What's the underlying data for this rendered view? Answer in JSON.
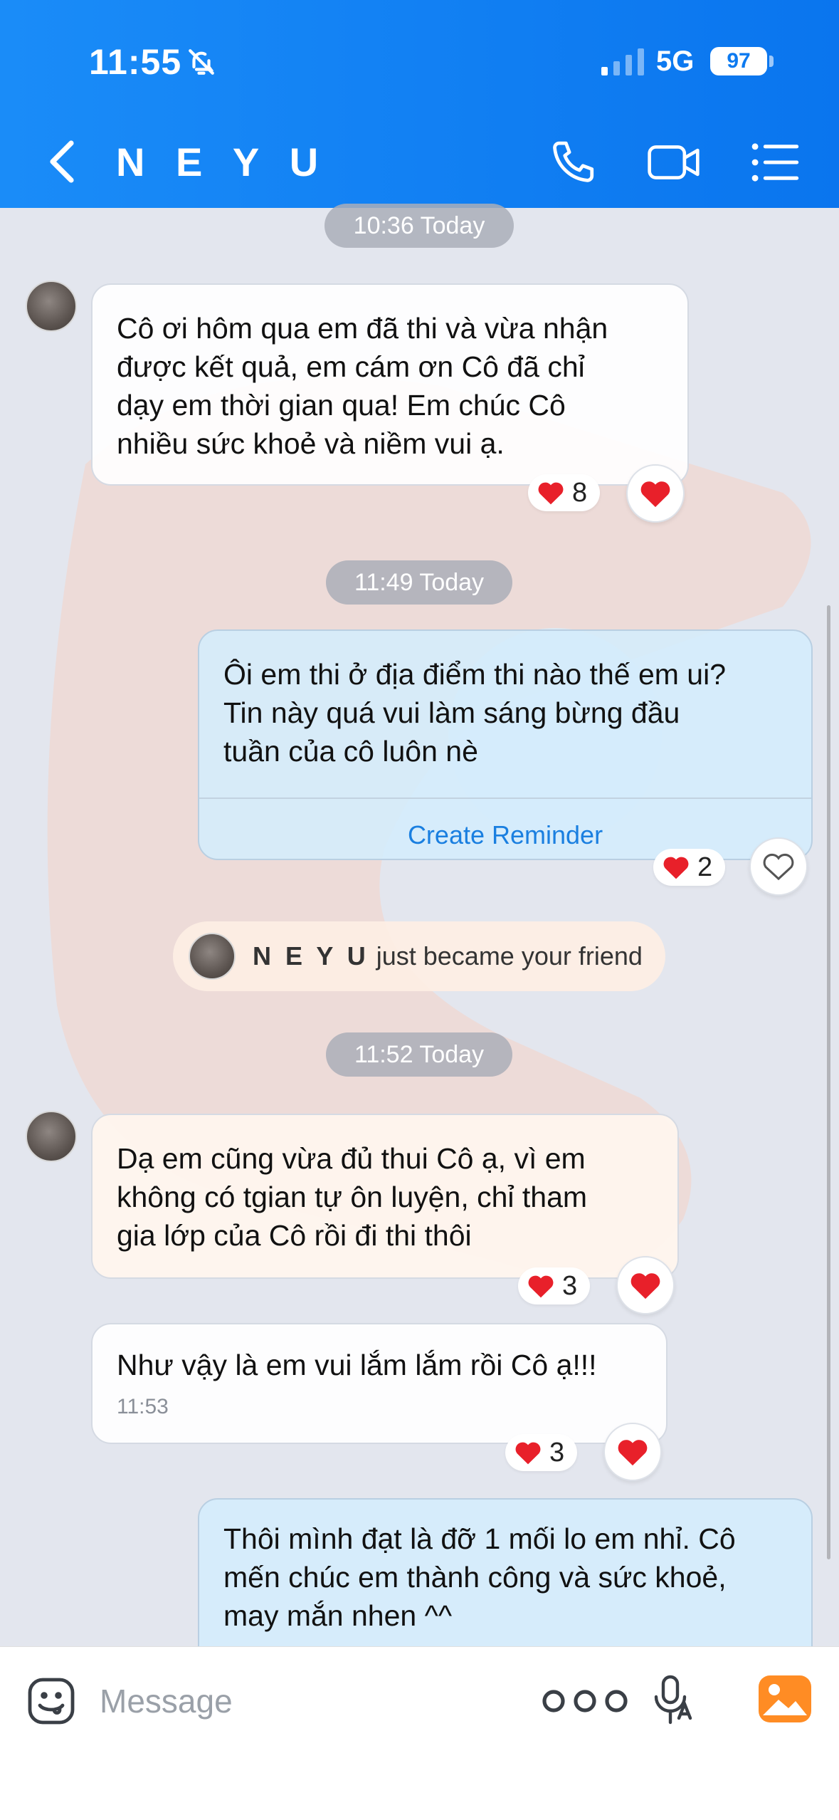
{
  "status_bar": {
    "time": "11:55",
    "network": "5G",
    "battery": "97"
  },
  "header": {
    "title": "N E Y U"
  },
  "chat": {
    "chips": [
      "10:36 Today",
      "11:49 Today",
      "11:52 Today"
    ],
    "msg1": {
      "text": "Cô ơi hôm qua em đã thi và vừa nhận\nđược kết quả, em cám ơn Cô đã chỉ\ndạy em thời gian qua! Em chúc Cô\nnhiều sức khoẻ và niềm vui ạ.",
      "reaction_count": "8"
    },
    "msg2": {
      "text": "Ôi em thi ở địa điểm thi nào thế em ui?\nTin này quá vui làm sáng bừng đầu\ntuần của cô luôn nè",
      "reminder_label": "Create Reminder",
      "reaction_count": "2"
    },
    "friend_notice": {
      "name": "N E Y U",
      "text": "just became your friend"
    },
    "msg3": {
      "text": "Dạ em cũng vừa đủ thui Cô ạ, vì em\nkhông có tgian tự ôn luyện, chỉ tham\ngia lớp của Cô rồi đi thi thôi",
      "reaction_count": "3"
    },
    "msg4": {
      "text": "Như vậy là em vui lắm lắm rồi Cô ạ!!!",
      "time": "11:53",
      "reaction_count": "3"
    },
    "msg5": {
      "text": "Thôi mình đạt là đỡ 1 mối lo em nhỉ. Cô\nmến chúc em thành công và sức khoẻ,\nmay mắn nhen ^^"
    }
  },
  "composer": {
    "placeholder": "Message"
  },
  "colors": {
    "header": "#0a75ee",
    "heart": "#e8202a",
    "link": "#1a7fe0"
  }
}
